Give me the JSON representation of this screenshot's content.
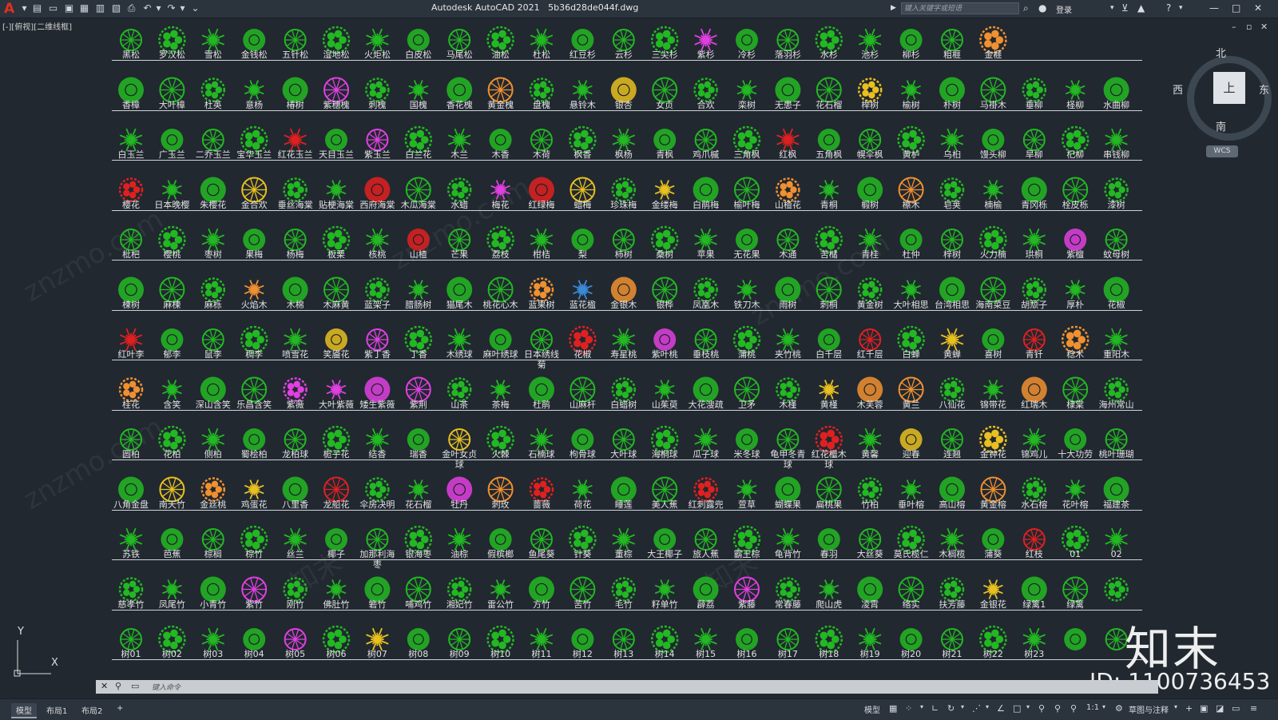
{
  "app": {
    "window_title": "Autodesk AutoCAD 2021",
    "file_name": "5b36d28de044f.dwg",
    "search_placeholder": "键入关键字或短语",
    "login_label": "登录"
  },
  "viewport": {
    "view_label": "[-][俯视][二维线框]"
  },
  "viewcube": {
    "north": "北",
    "south": "南",
    "west": "西",
    "east": "东",
    "face": "上",
    "wcs": "WCS"
  },
  "ucs": {
    "x": "X",
    "y": "Y"
  },
  "watermark": {
    "brand": "知末",
    "id_text": "ID: 1100736453",
    "site": "znzmo.com"
  },
  "command": {
    "placeholder": "键入命令",
    "close_glyph": "✕"
  },
  "status": {
    "tabs": [
      "模型",
      "布局1",
      "布局2"
    ],
    "add_tab": "+",
    "model_label": "模型",
    "scale": "1:1",
    "annotation": "草图与注释"
  },
  "colors": {
    "background": "#212830",
    "symbol_green": "#22b822",
    "symbol_bright": "#3edc3e",
    "magenta": "#e040e0",
    "orange": "#f09030",
    "red": "#e02020",
    "yellow": "#e8c020"
  },
  "plant_rows": [
    {
      "labels": [
        "黑松",
        "罗汉松",
        "雪松",
        "金钱松",
        "五针松",
        "湿地松",
        "火炬松",
        "白皮松",
        "马尾松",
        "油松",
        "杜松",
        "红豆杉",
        "云杉",
        "三尖杉",
        "紫杉",
        "冷杉",
        "落羽杉",
        "水杉",
        "池杉",
        "柳杉",
        "粗榧",
        "金榧"
      ],
      "types": [
        "g",
        "g",
        "g",
        "g",
        "g",
        "g",
        "g",
        "g",
        "g",
        "g",
        "g",
        "g",
        "g",
        "g",
        "m",
        "g",
        "g",
        "g",
        "g",
        "g",
        "g",
        "o"
      ]
    },
    {
      "labels": [
        "香樟",
        "大叶樟",
        "杜英",
        "意杨",
        "椿树",
        "紫穗槐",
        "刺槐",
        "国槐",
        "香花槐",
        "黄金槐",
        "盘槐",
        "悬铃木",
        "银杏",
        "女贞",
        "合欢",
        "栾树",
        "无患子",
        "花石榴",
        "榉树",
        "榆树",
        "朴树",
        "马褂木",
        "垂柳",
        "柽柳",
        "水曲柳"
      ],
      "types": [
        "g",
        "g",
        "g",
        "g",
        "g",
        "m",
        "g",
        "g",
        "g",
        "o",
        "g",
        "g",
        "y",
        "g",
        "g",
        "g",
        "g",
        "g",
        "y",
        "g",
        "g",
        "g",
        "g",
        "g",
        "g"
      ]
    },
    {
      "labels": [
        "白玉兰",
        "广玉兰",
        "二乔玉兰",
        "宝华玉兰",
        "红花玉兰",
        "天目玉兰",
        "紫玉兰",
        "白兰花",
        "木兰",
        "木香",
        "木荷",
        "枫香",
        "枫杨",
        "青枫",
        "鸡爪槭",
        "三角枫",
        "红枫",
        "五角枫",
        "幌伞枫",
        "黄栌",
        "乌桕",
        "馒头柳",
        "旱柳",
        "杞柳",
        "串钱柳"
      ],
      "types": [
        "g",
        "g",
        "g",
        "g",
        "r",
        "g",
        "m",
        "g",
        "g",
        "g",
        "g",
        "g",
        "g",
        "g",
        "g",
        "g",
        "r",
        "g",
        "g",
        "g",
        "g",
        "g",
        "g",
        "g",
        "g"
      ]
    },
    {
      "labels": [
        "樱花",
        "日本晚樱",
        "朱樱花",
        "金合欢",
        "垂丝海棠",
        "贴梗海棠",
        "西府海棠",
        "木瓜海棠",
        "水蜡",
        "梅花",
        "红绿梅",
        "蜡梅",
        "珍珠梅",
        "金缕梅",
        "白鹃梅",
        "榆叶梅",
        "山楂花",
        "青桐",
        "椴树",
        "檫木",
        "皂荚",
        "楠榆",
        "青冈栎",
        "栓皮栎",
        "漆树"
      ],
      "types": [
        "r",
        "g",
        "g",
        "y",
        "g",
        "g",
        "r",
        "g",
        "g",
        "m",
        "r",
        "y",
        "g",
        "y",
        "g",
        "g",
        "o",
        "g",
        "g",
        "o",
        "g",
        "g",
        "g",
        "g",
        "g"
      ]
    },
    {
      "labels": [
        "枇杷",
        "樱桃",
        "枣树",
        "果梅",
        "杨梅",
        "板栗",
        "核桃",
        "山楂",
        "芒果",
        "荔枝",
        "柑桔",
        "梨",
        "柿树",
        "桑树",
        "苹果",
        "无花果",
        "木通",
        "苦槠",
        "青桂",
        "杜仲",
        "梓树",
        "火力楠",
        "珙桐",
        "紫檀",
        "蚊母树"
      ],
      "types": [
        "g",
        "g",
        "g",
        "g",
        "g",
        "g",
        "g",
        "r",
        "g",
        "g",
        "g",
        "g",
        "g",
        "g",
        "g",
        "g",
        "g",
        "g",
        "g",
        "g",
        "g",
        "g",
        "g",
        "m",
        "g"
      ]
    },
    {
      "labels": [
        "楝树",
        "麻楝",
        "麻栎",
        "火焰木",
        "木棉",
        "木麻黄",
        "蓝架子",
        "腊肠树",
        "猫尾木",
        "桃花心木",
        "蓝果树",
        "蓝花楹",
        "金银木",
        "银桦",
        "凤凰木",
        "铁刀木",
        "雨树",
        "刺桐",
        "黄金树",
        "大叶相思",
        "台湾相思",
        "海南菜豆",
        "胡颓子",
        "厚朴",
        "花椒"
      ],
      "types": [
        "g",
        "g",
        "g",
        "o",
        "g",
        "g",
        "g",
        "g",
        "g",
        "g",
        "o",
        "b",
        "o",
        "g",
        "g",
        "g",
        "g",
        "g",
        "g",
        "g",
        "g",
        "g",
        "g",
        "g",
        "g"
      ]
    },
    {
      "labels": [
        "红叶李",
        "郁李",
        "鼠李",
        "稠李",
        "喷雪花",
        "笑靥花",
        "紫丁香",
        "丁香",
        "木绣球",
        "麻叶绣球",
        "日本绣线菊",
        "花椒",
        "寿星桃",
        "紫叶桃",
        "垂枝桃",
        "蒲桃",
        "夹竹桃",
        "白千层",
        "红千层",
        "白蝉",
        "黄蝉",
        "喜树",
        "青钎",
        "稔木",
        "重阳木"
      ],
      "types": [
        "r",
        "g",
        "g",
        "g",
        "g",
        "y",
        "m",
        "g",
        "g",
        "g",
        "g",
        "r",
        "g",
        "m",
        "g",
        "g",
        "g",
        "g",
        "r",
        "g",
        "y",
        "g",
        "r",
        "o",
        "g"
      ]
    },
    {
      "labels": [
        "桂花",
        "含笑",
        "深山含笑",
        "乐昌含笑",
        "紫薇",
        "大叶紫薇",
        "矮生紫薇",
        "紫荆",
        "山茶",
        "茶梅",
        "杜鹃",
        "山麻杆",
        "白蜡树",
        "山茱萸",
        "大花溲疏",
        "卫矛",
        "木槿",
        "黄槿",
        "木芙蓉",
        "黄兰",
        "八仙花",
        "锦带花",
        "红瑞木",
        "棣棠",
        "海州常山"
      ],
      "types": [
        "o",
        "g",
        "g",
        "g",
        "m",
        "m",
        "m",
        "m",
        "g",
        "g",
        "g",
        "g",
        "g",
        "g",
        "g",
        "g",
        "g",
        "y",
        "o",
        "o",
        "g",
        "g",
        "o",
        "g",
        "g"
      ]
    },
    {
      "labels": [
        "圆柏",
        "花柏",
        "侧柏",
        "蜀桧柏",
        "龙柏球",
        "栀子花",
        "结香",
        "瑞香",
        "金叶女贞球",
        "火棘",
        "石楠球",
        "枸骨球",
        "大叶球",
        "海桐球",
        "瓜子球",
        "米冬球",
        "龟甲冬青球",
        "红花檵木球",
        "黄馨",
        "迎春",
        "连翘",
        "金钟花",
        "锦鸡儿",
        "十大功劳",
        "桃叶珊瑚"
      ],
      "types": [
        "g",
        "g",
        "g",
        "g",
        "g",
        "g",
        "g",
        "g",
        "y",
        "g",
        "g",
        "g",
        "g",
        "g",
        "g",
        "g",
        "g",
        "r",
        "g",
        "y",
        "g",
        "y",
        "g",
        "g",
        "g"
      ]
    },
    {
      "labels": [
        "八角金盘",
        "南天竹",
        "金丝桃",
        "鸡蛋花",
        "八里香",
        "龙船花",
        "伞房决明",
        "花石榴",
        "牡丹",
        "刺玫",
        "蔷薇",
        "荷花",
        "睡莲",
        "美人蕉",
        "红刺露兜",
        "萱草",
        "蝴蝶果",
        "扁桃果",
        "竹柏",
        "垂叶榕",
        "高山榕",
        "黄金榕",
        "水石榕",
        "花叶榕",
        "福建茶"
      ],
      "types": [
        "g",
        "y",
        "o",
        "y",
        "g",
        "r",
        "g",
        "g",
        "m",
        "o",
        "r",
        "g",
        "g",
        "g",
        "r",
        "g",
        "g",
        "g",
        "g",
        "g",
        "g",
        "o",
        "g",
        "g",
        "g"
      ]
    },
    {
      "labels": [
        "苏铁",
        "芭蕉",
        "棕榈",
        "棕竹",
        "丝兰",
        "椰子",
        "加那利海枣",
        "银海枣",
        "油棕",
        "假槟榔",
        "鱼尾葵",
        "针葵",
        "董棕",
        "大王椰子",
        "旅人蕉",
        "霸王棕",
        "龟背竹",
        "春羽",
        "大丝葵",
        "莫氏榄仁",
        "木榈榄",
        "蒲葵",
        "红枝",
        "01",
        "02"
      ],
      "types": [
        "g",
        "g",
        "g",
        "g",
        "g",
        "g",
        "g",
        "g",
        "g",
        "g",
        "g",
        "g",
        "g",
        "g",
        "g",
        "g",
        "g",
        "g",
        "g",
        "g",
        "g",
        "g",
        "r",
        "g",
        "g"
      ]
    },
    {
      "labels": [
        "慈孝竹",
        "凤尾竹",
        "小青竹",
        "紫竹",
        "刚竹",
        "佛肚竹",
        "箬竹",
        "哺鸡竹",
        "湘妃竹",
        "雷公竹",
        "方竹",
        "苦竹",
        "毛竹",
        "籽单竹",
        "薜荔",
        "紫藤",
        "常春藤",
        "爬山虎",
        "凌霄",
        "络实",
        "扶芳藤",
        "金银花",
        "绿篱1",
        "绿篱",
        ""
      ],
      "types": [
        "g",
        "g",
        "g",
        "m",
        "g",
        "g",
        "g",
        "g",
        "g",
        "g",
        "g",
        "g",
        "g",
        "g",
        "g",
        "m",
        "g",
        "g",
        "g",
        "g",
        "g",
        "y",
        "g",
        "g",
        "g"
      ]
    },
    {
      "labels": [
        "树01",
        "树02",
        "树03",
        "树04",
        "树05",
        "树06",
        "树07",
        "树08",
        "树09",
        "树10",
        "树11",
        "树12",
        "树13",
        "树14",
        "树15",
        "树16",
        "树17",
        "树18",
        "树19",
        "树20",
        "树21",
        "树22",
        "树23",
        "",
        ""
      ],
      "types": [
        "g",
        "g",
        "g",
        "g",
        "m",
        "g",
        "y",
        "g",
        "g",
        "g",
        "g",
        "g",
        "g",
        "g",
        "g",
        "g",
        "g",
        "g",
        "g",
        "g",
        "g",
        "g",
        "g",
        "g",
        "g"
      ]
    }
  ]
}
